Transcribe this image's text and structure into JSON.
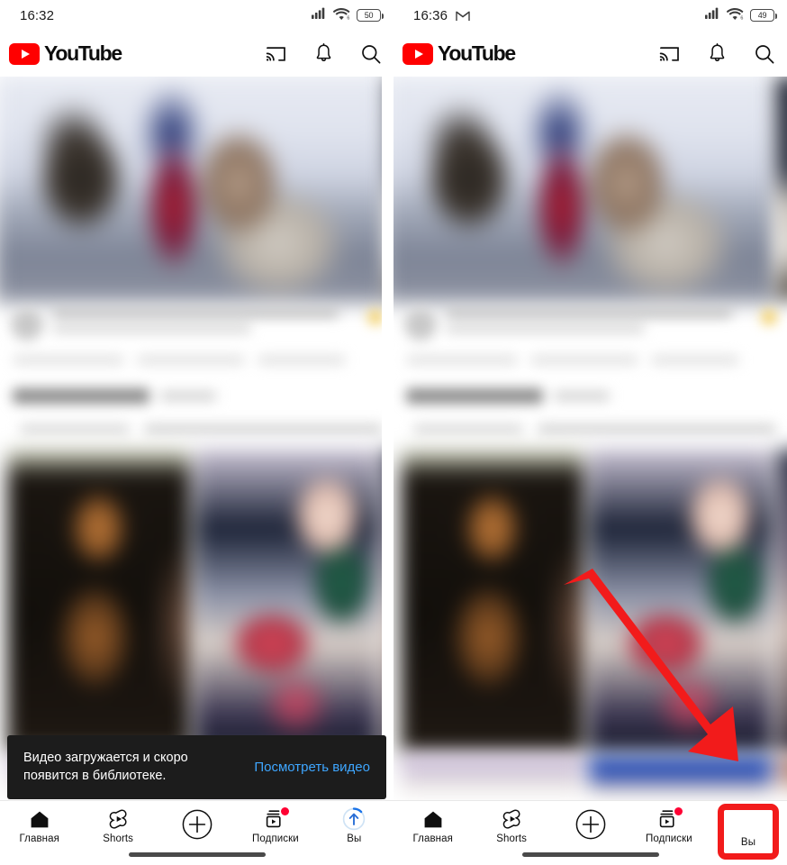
{
  "app": {
    "name": "YouTube",
    "logo_text": "YouTube"
  },
  "panels": [
    {
      "id": "left",
      "status": {
        "time": "16:32",
        "gmail_icon": "gmail-icon",
        "show_gmail": false,
        "signal_icon": "cellular-signal-icon",
        "wifi_icon": "wifi6-icon",
        "battery_level": "50"
      },
      "header": {
        "logo_text": "YouTube",
        "actions": [
          "cast-icon",
          "notifications-bell-icon",
          "search-icon"
        ]
      },
      "snackbar": {
        "visible": true,
        "message": "Видео загружается и скоро появится в библиотеке.",
        "action_label": "Посмотреть видео",
        "action_color": "#3ea6ff",
        "background": "#1c1c1c"
      },
      "bottom_nav": {
        "items": [
          {
            "label": "Главная",
            "icon": "home-icon",
            "badge": false,
            "active": true
          },
          {
            "label": "Shorts",
            "icon": "shorts-icon",
            "badge": false,
            "active": false
          },
          {
            "label": "",
            "icon": "create-plus-icon",
            "badge": false,
            "active": false
          },
          {
            "label": "Подписки",
            "icon": "subscriptions-icon",
            "badge": true,
            "active": false
          },
          {
            "label": "Вы",
            "icon": "upload-progress-avatar-icon",
            "badge": false,
            "active": false
          }
        ]
      },
      "highlight": {
        "visible": false,
        "color": "#f21b1b",
        "target_label": "Вы"
      },
      "arrow": {
        "visible": false,
        "color": "#f21b1b"
      }
    },
    {
      "id": "right",
      "status": {
        "time": "16:36",
        "gmail_icon": "gmail-icon",
        "show_gmail": true,
        "signal_icon": "cellular-signal-icon",
        "wifi_icon": "wifi6-icon",
        "battery_level": "49"
      },
      "header": {
        "logo_text": "YouTube",
        "actions": [
          "cast-icon",
          "notifications-bell-icon",
          "search-icon"
        ]
      },
      "snackbar": {
        "visible": false,
        "message": "",
        "action_label": "",
        "action_color": "#3ea6ff",
        "background": "#1c1c1c"
      },
      "bottom_nav": {
        "items": [
          {
            "label": "Главная",
            "icon": "home-icon",
            "badge": false,
            "active": true
          },
          {
            "label": "Shorts",
            "icon": "shorts-icon",
            "badge": false,
            "active": false
          },
          {
            "label": "",
            "icon": "create-plus-icon",
            "badge": false,
            "active": false
          },
          {
            "label": "Подписки",
            "icon": "subscriptions-icon",
            "badge": true,
            "active": false
          },
          {
            "label": "Вы",
            "icon": "account-avatar-icon",
            "badge": false,
            "active": false
          }
        ]
      },
      "highlight": {
        "visible": true,
        "color": "#f21b1b",
        "target_label": "Вы"
      },
      "arrow": {
        "visible": true,
        "color": "#f21b1b"
      }
    }
  ],
  "feed": {
    "blurred": true,
    "note": "Content is blurred/censored in the screenshot",
    "video_card": {
      "thumbnail": "blurred-video-thumbnail",
      "title": "",
      "channel": "",
      "stats": ""
    },
    "shorts_shelf": {
      "title": "",
      "items": [
        "blurred-short-1",
        "blurred-short-2",
        "blurred-short-3"
      ]
    }
  }
}
